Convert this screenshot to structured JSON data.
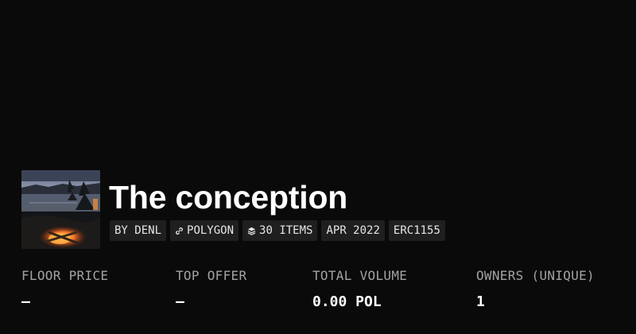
{
  "collection": {
    "title": "The conception",
    "thumbnail_alt": "Sunset lake with campfire",
    "tags": [
      {
        "label": "BY DENL",
        "icon": ""
      },
      {
        "label": "POLYGON",
        "icon": "link-icon"
      },
      {
        "label": "30 ITEMS",
        "icon": "layers-icon"
      },
      {
        "label": "APR 2022",
        "icon": ""
      },
      {
        "label": "ERC1155",
        "icon": ""
      }
    ]
  },
  "stats": [
    {
      "label": "FLOOR PRICE",
      "value": "—"
    },
    {
      "label": "TOP OFFER",
      "value": "—"
    },
    {
      "label": "TOTAL VOLUME",
      "value": "0.00 POL"
    },
    {
      "label": "OWNERS (UNIQUE)",
      "value": "1"
    }
  ],
  "colors": {
    "background": "#0b0b0b",
    "tag_background": "#1f1f1f",
    "label_text": "#a3a3a3",
    "value_text": "#ffffff"
  }
}
